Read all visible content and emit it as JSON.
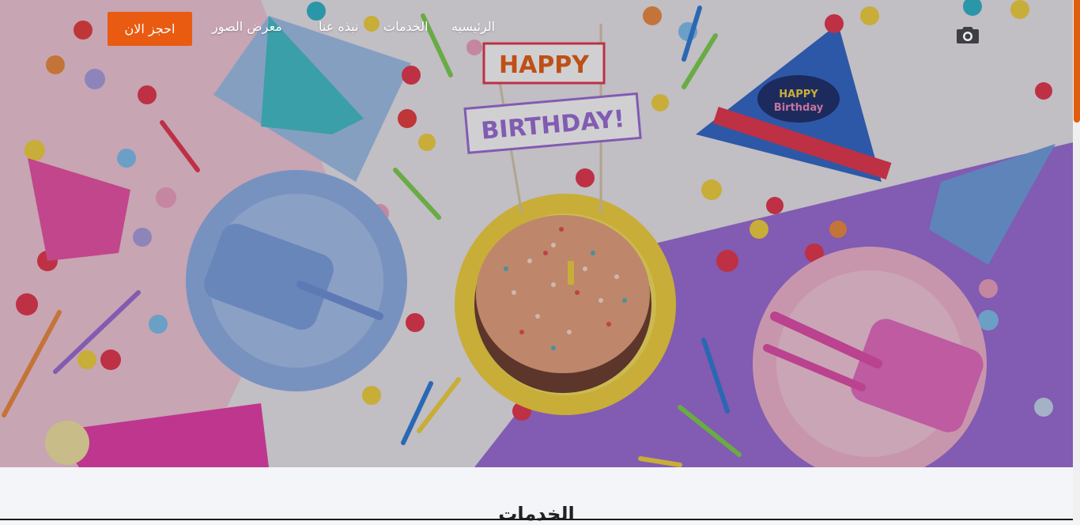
{
  "nav": {
    "book_now": "احجز الان",
    "links": [
      "الرئيسيه",
      "الخدمات",
      "نبذه عنا",
      "معرض الصور"
    ]
  },
  "hero": {
    "banner_top": "HAPPY",
    "banner_bottom": "BIRTHDAY!",
    "hat_text_1": "HAPPY",
    "hat_text_2": "Birthday"
  },
  "services": {
    "title": "الخدمات"
  },
  "colors": {
    "accent": "#e85b10",
    "purple": "#9b6ad6",
    "pink": "#f5b5cf",
    "light_blue": "#c8d8ef",
    "yellow": "#f5d23a"
  },
  "icons": {
    "logo": "camera-icon"
  }
}
